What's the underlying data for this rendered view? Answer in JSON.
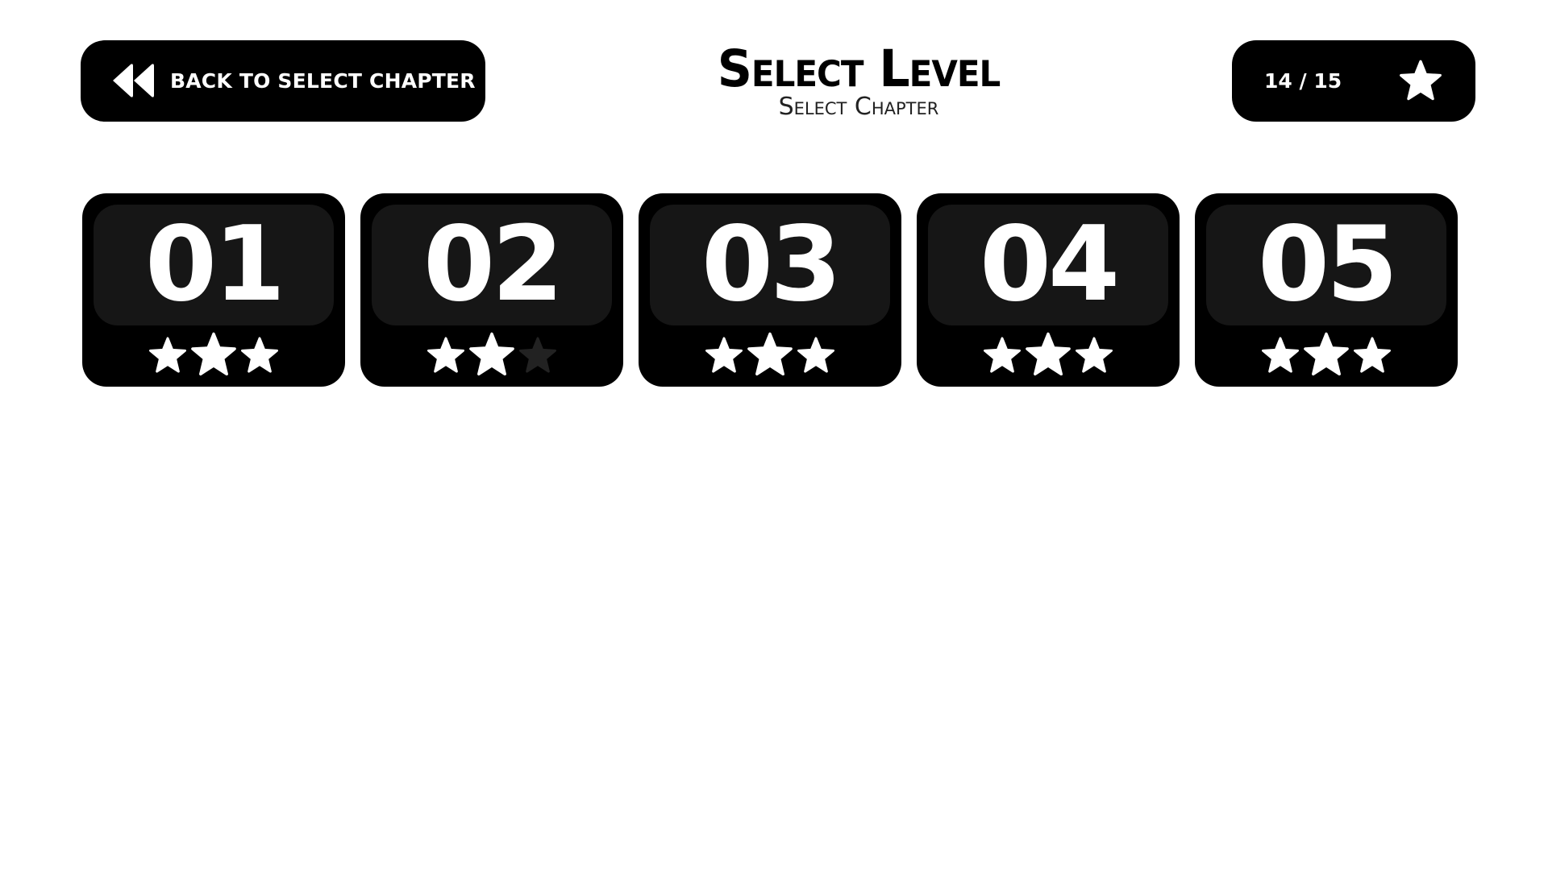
{
  "header": {
    "back_button_label": "BACK TO SELECT CHAPTER",
    "title": "Select Level",
    "subtitle": "Select Chapter",
    "star_counter": {
      "text": "14 / 15",
      "earned": 14,
      "total": 15
    }
  },
  "icons": {
    "back": "double-chevron-left-icon",
    "star": "star-icon"
  },
  "colors": {
    "background": "#ffffff",
    "panel": "#000000",
    "number_panel": "#161616",
    "star_filled": "#ffffff",
    "star_empty": "#222222",
    "text": "#ffffff"
  },
  "levels": [
    {
      "number": "01",
      "stars_earned": 3,
      "stars_total": 3
    },
    {
      "number": "02",
      "stars_earned": 2,
      "stars_total": 3
    },
    {
      "number": "03",
      "stars_earned": 3,
      "stars_total": 3
    },
    {
      "number": "04",
      "stars_earned": 3,
      "stars_total": 3
    },
    {
      "number": "05",
      "stars_earned": 3,
      "stars_total": 3
    }
  ]
}
